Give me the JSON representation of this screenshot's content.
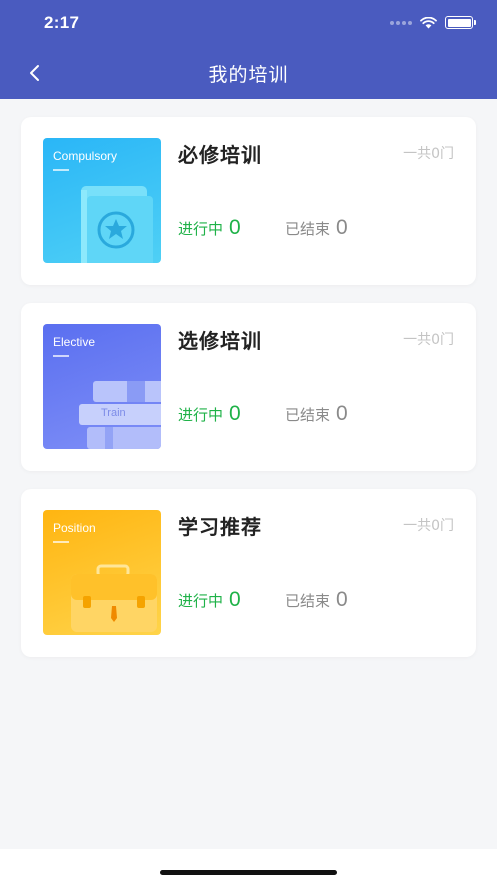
{
  "status_bar": {
    "time": "2:17"
  },
  "nav": {
    "title": "我的培训"
  },
  "cards": [
    {
      "title": "必修培训",
      "total": "一共0门",
      "image_tag": "Compulsory",
      "active_label": "进行中",
      "active_count": "0",
      "ended_label": "已结束",
      "ended_count": "0"
    },
    {
      "title": "选修培训",
      "total": "一共0门",
      "image_tag": "Elective",
      "image_text": "Train",
      "active_label": "进行中",
      "active_count": "0",
      "ended_label": "已结束",
      "ended_count": "0"
    },
    {
      "title": "学习推荐",
      "total": "一共0门",
      "image_tag": "Position",
      "active_label": "进行中",
      "active_count": "0",
      "ended_label": "已结束",
      "ended_count": "0"
    }
  ],
  "colors": {
    "header": "#4a5bbf",
    "active": "#1fb248",
    "ended": "#8a8a8a"
  },
  "icons": [
    "back-arrow-icon",
    "wifi-icon",
    "battery-icon",
    "signal-icon"
  ]
}
